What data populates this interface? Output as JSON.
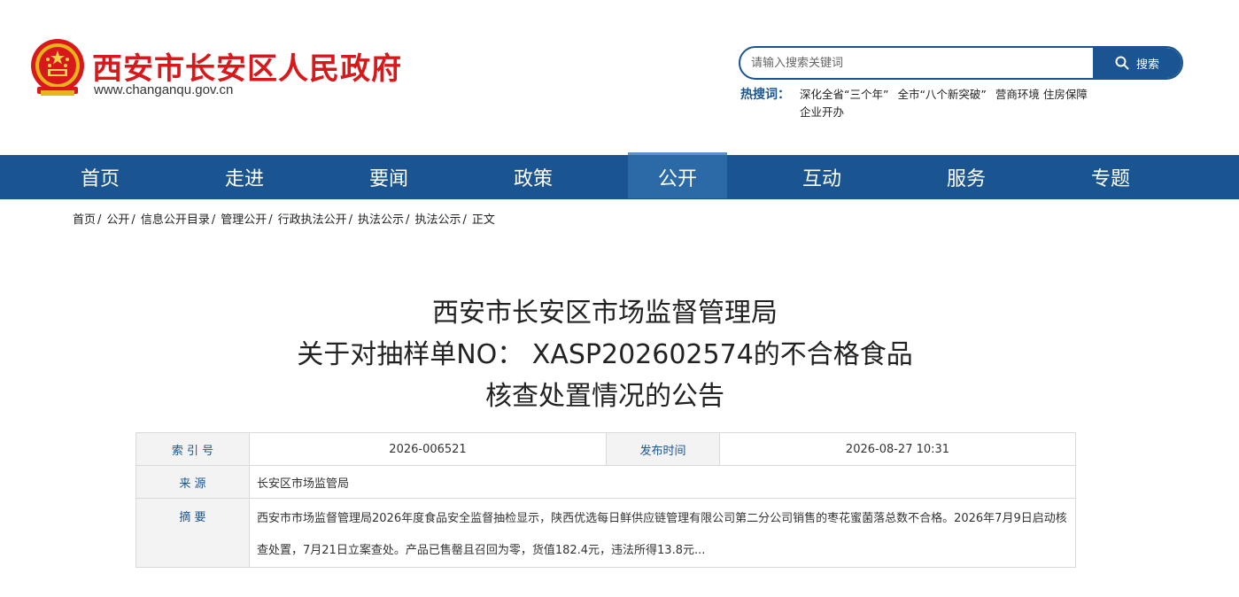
{
  "header": {
    "site_title": "西安市长安区人民政府",
    "site_url": "www.changanqu.gov.cn",
    "search_placeholder": "请输入搜索关键词",
    "search_button": "搜索",
    "hot_label": "热搜词：",
    "hot_words": [
      "深化全省“三个年”",
      "全市“八个新突破”",
      "营商环境",
      "住房保障",
      "企业开办"
    ]
  },
  "nav": {
    "items": [
      "首页",
      "走进",
      "要闻",
      "政策",
      "公开",
      "互动",
      "服务",
      "专题"
    ],
    "active": "公开"
  },
  "breadcrumb": [
    "首页",
    "公开",
    "信息公开目录",
    "管理公开",
    "行政执法公开",
    "执法公示",
    "执法公示",
    "正文"
  ],
  "article": {
    "title_lines": [
      "西安市长安区市场监督管理局",
      "关于对抽样单NO： XASP202602574的不合格食品",
      "核查处置情况的公告"
    ]
  },
  "info": {
    "index_label": "索 引 号",
    "index_value": "2026-006521",
    "date_label": "发布时间",
    "date_value": "2026-08-27 10:31",
    "source_label": "来 源",
    "source_value": "长安区市场监管局",
    "summary_label": "摘 要",
    "summary_value": "西安市市场监督管理局2026年度食品安全监督抽检显示，陕西优选每日鲜供应链管理有限公司第二分公司销售的枣花蜜菌落总数不合格。2026年7月9日启动核查处置，7月21日立案查处。产品已售罄且召回为零，货值182.4元，违法所得13.8元..."
  },
  "colors": {
    "primary": "#1b5591",
    "title_red": "#d7191c",
    "active_nav": "#2b6aa7"
  }
}
